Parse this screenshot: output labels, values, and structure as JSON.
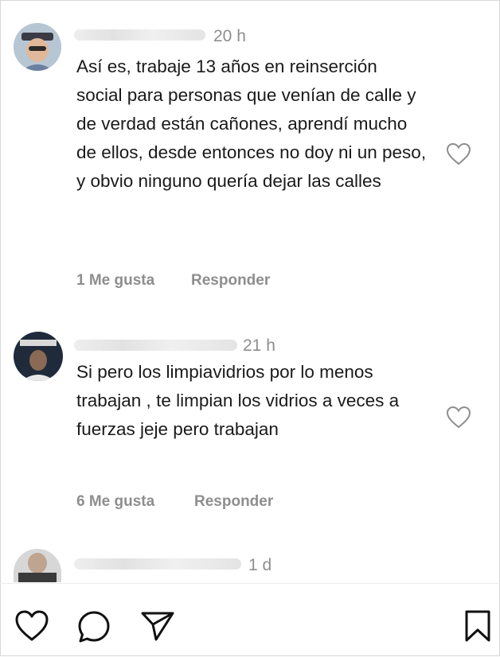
{
  "comments": [
    {
      "time": "20 h",
      "text": "Así es, trabaje 13 años en reinserción social para personas que venían de calle y de verdad están cañones, aprendí mucho de ellos, desde entonces no doy ni un peso, y obvio ninguno quería dejar las calles",
      "likes": "1 Me gusta",
      "reply": "Responder"
    },
    {
      "time": "21 h",
      "text": "Si pero los limpiavidrios por lo menos trabajan , te limpian los vidrios a veces a fuerzas jeje pero trabajan",
      "likes": "6 Me gusta",
      "reply": "Responder"
    },
    {
      "time": "1 d"
    }
  ],
  "icons": {
    "comment_like": "heart-outline-icon",
    "bar_like": "heart-icon",
    "bar_comment": "comment-bubble-icon",
    "bar_share": "paper-plane-icon",
    "bar_save": "bookmark-icon"
  }
}
